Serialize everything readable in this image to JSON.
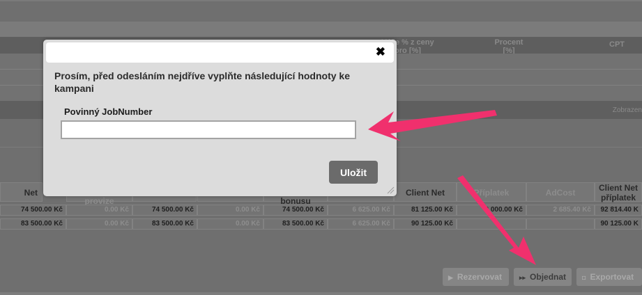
{
  "background": {
    "header_cells": [
      {
        "name": "header-vyse-z-ceny",
        "line1": "Výše % z ceny",
        "line2": "pro [%]"
      },
      {
        "name": "header-procent",
        "line1": "Procent",
        "line2": "[%]"
      },
      {
        "name": "header-cpt",
        "line1": "CPT",
        "line2": ""
      }
    ],
    "zobrazeni_label": "Zobrazen",
    "table_headers": [
      {
        "label": "Net",
        "sub": ""
      },
      {
        "label": "",
        "sub": "provize"
      },
      {
        "label": "",
        "sub": ""
      },
      {
        "label": "",
        "sub": ""
      },
      {
        "label": "",
        "sub": "bonusu"
      },
      {
        "label": "",
        "sub": ""
      },
      {
        "label": "Client Net",
        "sub": ""
      },
      {
        "label": "Příplatek",
        "sub": ""
      },
      {
        "label": "AdCost",
        "sub": ""
      },
      {
        "label": "Client Net",
        "sub": "příplatek"
      }
    ],
    "rows": [
      [
        "74 500.00 Kč",
        "0.00 Kč",
        "74 500.00 Kč",
        "0.00 Kč",
        "74 500.00 Kč",
        "6 625.00 Kč",
        "81 125.00 Kč",
        "9 000.00 Kč",
        "2 685.40 Kč",
        "92 814.40 K"
      ],
      [
        "83 500.00 Kč",
        "0.00 Kč",
        "83 500.00 Kč",
        "0.00 Kč",
        "83 500.00 Kč",
        "6 625.00 Kč",
        "90 125.00 Kč",
        "",
        "",
        "90 125.00 K"
      ]
    ],
    "buttons": [
      {
        "name": "rezervovat-button",
        "label": "Rezervovat",
        "icon": "▶"
      },
      {
        "name": "objednat-button",
        "label": "Objednat",
        "icon": "▸▸"
      },
      {
        "name": "exportovat-button",
        "label": "Exportovat",
        "icon": "◘"
      }
    ]
  },
  "modal": {
    "close_glyph": "✖",
    "message": "Prosím, před odesláním nejdříve vyplňte následující hodnoty ke kampani",
    "field_label": "Povinný JobNumber",
    "field_value": "",
    "save_label": "Uložit"
  },
  "colors": {
    "overlay": "#6f6f6f",
    "modal_bg": "#dcdcdc",
    "arrow": "#f0306d",
    "save_button": "#6b6b6b"
  }
}
